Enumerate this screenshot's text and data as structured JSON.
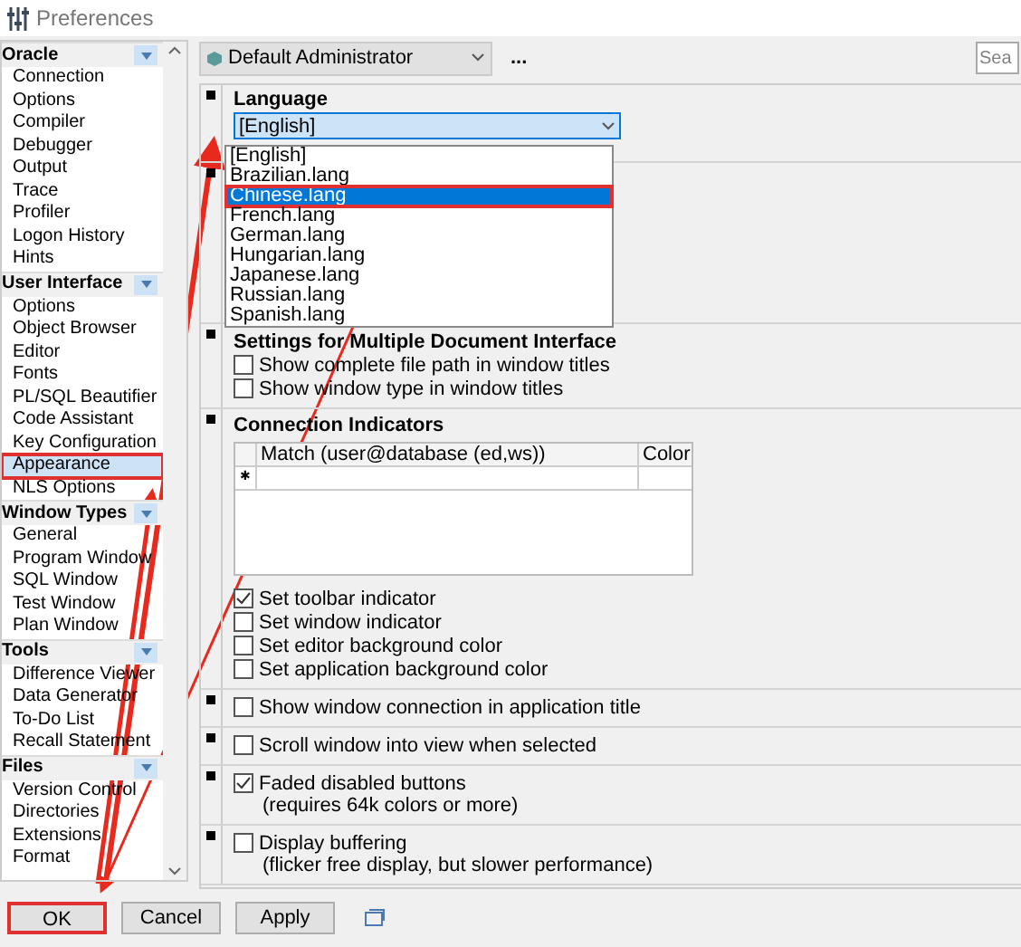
{
  "window": {
    "title": "Preferences"
  },
  "sidebar": {
    "groups": [
      {
        "title": "Oracle",
        "items": [
          {
            "label": "Connection",
            "selected": false
          },
          {
            "label": "Options",
            "selected": false
          },
          {
            "label": "Compiler",
            "selected": false
          },
          {
            "label": "Debugger",
            "selected": false
          },
          {
            "label": "Output",
            "selected": false
          },
          {
            "label": "Trace",
            "selected": false
          },
          {
            "label": "Profiler",
            "selected": false
          },
          {
            "label": "Logon History",
            "selected": false
          },
          {
            "label": "Hints",
            "selected": false
          }
        ]
      },
      {
        "title": "User Interface",
        "items": [
          {
            "label": "Options",
            "selected": false
          },
          {
            "label": "Object Browser",
            "selected": false
          },
          {
            "label": "Editor",
            "selected": false
          },
          {
            "label": "Fonts",
            "selected": false
          },
          {
            "label": "PL/SQL Beautifier",
            "selected": false
          },
          {
            "label": "Code Assistant",
            "selected": false
          },
          {
            "label": "Key Configuration",
            "selected": false
          },
          {
            "label": "Appearance",
            "selected": true
          },
          {
            "label": "NLS Options",
            "selected": false
          }
        ]
      },
      {
        "title": "Window Types",
        "items": [
          {
            "label": "General",
            "selected": false
          },
          {
            "label": "Program Window",
            "selected": false
          },
          {
            "label": "SQL Window",
            "selected": false
          },
          {
            "label": "Test Window",
            "selected": false
          },
          {
            "label": "Plan Window",
            "selected": false
          }
        ]
      },
      {
        "title": "Tools",
        "items": [
          {
            "label": "Difference Viewer",
            "selected": false
          },
          {
            "label": "Data Generator",
            "selected": false
          },
          {
            "label": "To-Do List",
            "selected": false
          },
          {
            "label": "Recall Statement",
            "selected": false
          }
        ]
      },
      {
        "title": "Files",
        "items": [
          {
            "label": "Version Control",
            "selected": false
          },
          {
            "label": "Directories",
            "selected": false
          },
          {
            "label": "Extensions",
            "selected": false
          },
          {
            "label": "Format",
            "selected": false
          }
        ]
      }
    ]
  },
  "toolbar": {
    "profile": "Default Administrator",
    "more_button": "...",
    "search": {
      "placeholder": "Sea"
    }
  },
  "sections": [
    {
      "kind": "language",
      "title": "Language",
      "value": "[English]",
      "options": [
        {
          "label": "[English]",
          "highlighted": false
        },
        {
          "label": "Brazilian.lang",
          "highlighted": false
        },
        {
          "label": "Chinese.lang",
          "highlighted": true
        },
        {
          "label": "French.lang",
          "highlighted": false
        },
        {
          "label": "German.lang",
          "highlighted": false
        },
        {
          "label": "Hungarian.lang",
          "highlighted": false
        },
        {
          "label": "Japanese.lang",
          "highlighted": false
        },
        {
          "label": "Russian.lang",
          "highlighted": false
        },
        {
          "label": "Spanish.lang",
          "highlighted": false
        }
      ]
    },
    {
      "kind": "hidden"
    },
    {
      "kind": "checks",
      "title": "Settings for Multiple Document Interface",
      "items": [
        {
          "label": "Show complete file path in window titles",
          "checked": false
        },
        {
          "label": "Show window type in window titles",
          "checked": false
        }
      ]
    },
    {
      "kind": "indicators",
      "title": "Connection Indicators",
      "columns": [
        "Match (user@database (ed,ws))",
        "Color"
      ],
      "new_row_marker": "✱",
      "items": [
        {
          "label": "Set toolbar indicator",
          "checked": true
        },
        {
          "label": "Set window indicator",
          "checked": false
        },
        {
          "label": "Set editor background color",
          "checked": false
        },
        {
          "label": "Set application background color",
          "checked": false
        }
      ]
    },
    {
      "kind": "checks",
      "items": [
        {
          "label": "Show window connection in application title",
          "checked": false
        }
      ]
    },
    {
      "kind": "checks",
      "items": [
        {
          "label": "Scroll window into view when selected",
          "checked": false
        }
      ]
    },
    {
      "kind": "checks",
      "items": [
        {
          "label": "Faded disabled buttons",
          "note": "(requires 64k colors or more)",
          "checked": true
        }
      ]
    },
    {
      "kind": "checks",
      "items": [
        {
          "label": "Display buffering",
          "note": "(flicker free display, but slower performance)",
          "checked": false
        }
      ]
    }
  ],
  "buttons": [
    {
      "label": "OK",
      "highlighted": true
    },
    {
      "label": "Cancel",
      "highlighted": false
    },
    {
      "label": "Apply",
      "highlighted": false
    }
  ]
}
